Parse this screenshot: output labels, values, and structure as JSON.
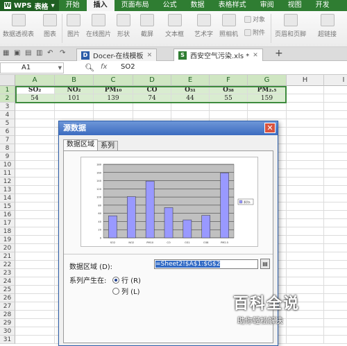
{
  "app": {
    "name": "表格",
    "logo": "WPS",
    "tabs": [
      "开始",
      "插入",
      "页面布局",
      "公式",
      "数据",
      "表格样式",
      "审阅",
      "视图",
      "开发"
    ],
    "active_tab": "插入"
  },
  "ribbon": {
    "buttons": [
      "数据透视表",
      "图表",
      "图片",
      "在线图片",
      "形状",
      "截屏",
      "文本框",
      "艺术字",
      "照相机",
      "页眉和页脚",
      "超链接"
    ],
    "small_buttons": [
      "对象",
      "附件"
    ]
  },
  "doc_tabs": [
    {
      "label": "Docer-在线模板",
      "icon": "D"
    },
    {
      "label": "西安空气污染.xls *",
      "icon": "S"
    }
  ],
  "formula_bar": {
    "name_box": "A1",
    "fx": "fx",
    "content": "SO2"
  },
  "sheet": {
    "columns": [
      "A",
      "B",
      "C",
      "D",
      "E",
      "F",
      "G",
      "H",
      "I"
    ],
    "rows": [
      "1",
      "2",
      "3",
      "4",
      "5",
      "6",
      "7",
      "8",
      "9",
      "10",
      "11",
      "12",
      "13",
      "14",
      "15",
      "16",
      "17",
      "18",
      "19",
      "20",
      "21",
      "22",
      "23",
      "24",
      "25",
      "26",
      "27",
      "28",
      "29",
      "30",
      "31"
    ],
    "headers": [
      "SO₂",
      "NO₂",
      "PM₁₀",
      "CO",
      "O₃₁",
      "O₃₈",
      "PM₂.₅"
    ],
    "values": [
      "54",
      "101",
      "139",
      "74",
      "44",
      "55",
      "159"
    ]
  },
  "dialog": {
    "title": "源数据",
    "tabs": [
      "数据区域",
      "系列"
    ],
    "range_label": "数据区域 (D):",
    "range_value": "=Sheet2!$A$1:$G$2",
    "series_in_label": "系列产生在:",
    "radio_rows": "行 (R)",
    "radio_cols": "列 (L)",
    "row_selected": true
  },
  "chart_data": {
    "type": "bar",
    "categories": [
      "SO2",
      "NO2",
      "PM10",
      "CO",
      "O31",
      "O38",
      "PM2.5"
    ],
    "series": [
      {
        "name": "系列1",
        "values": [
          54,
          101,
          139,
          74,
          44,
          55,
          159
        ]
      }
    ],
    "ylim": [
      0,
      180
    ],
    "yticks": [
      "0",
      "20",
      "40",
      "60",
      "80",
      "100",
      "120",
      "140",
      "160",
      "180"
    ],
    "grid": true,
    "legend": "right",
    "bar_color": "#9999ff",
    "plot_bg": "#c0c0c0"
  },
  "watermark": {
    "big": "百科全说",
    "small": "助你轻松解决"
  },
  "colors": {
    "accent": "#2f7d32",
    "selection": "#d9ecd0",
    "dialog_title": "#3c6cc0"
  }
}
